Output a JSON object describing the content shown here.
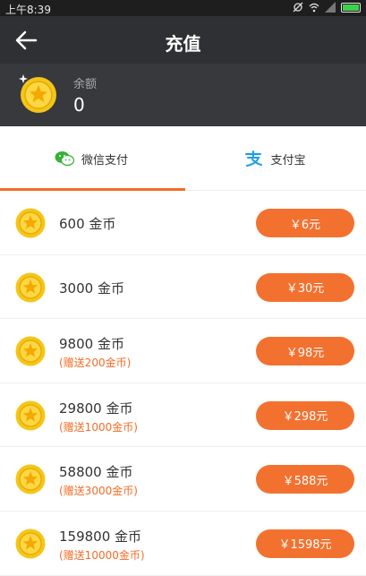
{
  "status_bar": {
    "time": "上午8:39"
  },
  "header": {
    "title": "充值",
    "back_icon": "back-arrow-icon"
  },
  "balance": {
    "label": "余额",
    "value": "0"
  },
  "tabs": [
    {
      "label": "微信支付",
      "icon": "wechat-icon",
      "active": true
    },
    {
      "label": "支付宝",
      "icon": "alipay-icon",
      "active": false
    }
  ],
  "colors": {
    "accent": "#f3712f",
    "header_bg": "#2f3033",
    "balance_bg": "#38393c"
  },
  "packages": [
    {
      "coins": "600 金币",
      "bonus": "",
      "price": "￥6元"
    },
    {
      "coins": "3000 金币",
      "bonus": "",
      "price": "￥30元"
    },
    {
      "coins": "9800 金币",
      "bonus": "(赠送200金币)",
      "price": "￥98元"
    },
    {
      "coins": "29800 金币",
      "bonus": "(赠送1000金币)",
      "price": "￥298元"
    },
    {
      "coins": "58800 金币",
      "bonus": "(赠送3000金币)",
      "price": "￥588元"
    },
    {
      "coins": "159800 金币",
      "bonus": "(赠送10000金币)",
      "price": "￥1598元"
    }
  ]
}
